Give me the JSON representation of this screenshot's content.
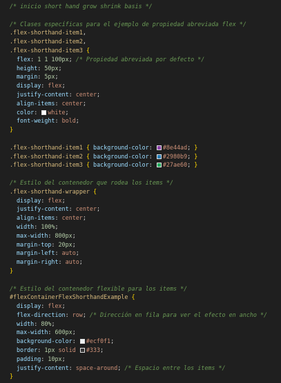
{
  "lines": [
    [
      {
        "t": "/* inicio short hand grow shrink basis */",
        "c": "comment"
      }
    ],
    [],
    [
      {
        "t": "/* Clases específicas para el ejemplo de propiedad abreviada flex */",
        "c": "comment"
      }
    ],
    [
      {
        "t": ".flex-shorthand-item1",
        "c": "selector"
      },
      {
        "t": ",",
        "c": "punct"
      }
    ],
    [
      {
        "t": ".flex-shorthand-item2",
        "c": "selector"
      },
      {
        "t": ",",
        "c": "punct"
      }
    ],
    [
      {
        "t": ".flex-shorthand-item3",
        "c": "selector"
      },
      {
        "t": " ",
        "c": "punct"
      },
      {
        "t": "{",
        "c": "brace"
      }
    ],
    [
      {
        "indent": 1
      },
      {
        "t": "flex",
        "c": "prop"
      },
      {
        "t": ": ",
        "c": "punct"
      },
      {
        "t": "1 1 100px",
        "c": "number"
      },
      {
        "t": "; ",
        "c": "punct"
      },
      {
        "t": "/* Propiedad abreviada por defecto */",
        "c": "comment"
      }
    ],
    [
      {
        "indent": 1
      },
      {
        "t": "height",
        "c": "prop"
      },
      {
        "t": ": ",
        "c": "punct"
      },
      {
        "t": "50px",
        "c": "number"
      },
      {
        "t": ";",
        "c": "punct"
      }
    ],
    [
      {
        "indent": 1
      },
      {
        "t": "margin",
        "c": "prop"
      },
      {
        "t": ": ",
        "c": "punct"
      },
      {
        "t": "5px",
        "c": "number"
      },
      {
        "t": ";",
        "c": "punct"
      }
    ],
    [
      {
        "indent": 1
      },
      {
        "t": "display",
        "c": "prop"
      },
      {
        "t": ": ",
        "c": "punct"
      },
      {
        "t": "flex",
        "c": "value"
      },
      {
        "t": ";",
        "c": "punct"
      }
    ],
    [
      {
        "indent": 1
      },
      {
        "t": "justify-content",
        "c": "prop"
      },
      {
        "t": ": ",
        "c": "punct"
      },
      {
        "t": "center",
        "c": "value"
      },
      {
        "t": ";",
        "c": "punct"
      }
    ],
    [
      {
        "indent": 1
      },
      {
        "t": "align-items",
        "c": "prop"
      },
      {
        "t": ": ",
        "c": "punct"
      },
      {
        "t": "center",
        "c": "value"
      },
      {
        "t": ";",
        "c": "punct"
      }
    ],
    [
      {
        "indent": 1
      },
      {
        "t": "color",
        "c": "prop"
      },
      {
        "t": ": ",
        "c": "punct"
      },
      {
        "swatch": "#ffffff"
      },
      {
        "t": "white",
        "c": "value"
      },
      {
        "t": ";",
        "c": "punct"
      }
    ],
    [
      {
        "indent": 1
      },
      {
        "t": "font-weight",
        "c": "prop"
      },
      {
        "t": ": ",
        "c": "punct"
      },
      {
        "t": "bold",
        "c": "value"
      },
      {
        "t": ";",
        "c": "punct"
      }
    ],
    [
      {
        "t": "}",
        "c": "brace"
      }
    ],
    [],
    [
      {
        "t": ".flex-shorthand-item1",
        "c": "selector"
      },
      {
        "t": " ",
        "c": "punct"
      },
      {
        "t": "{",
        "c": "brace"
      },
      {
        "t": " ",
        "c": "punct"
      },
      {
        "t": "background-color",
        "c": "prop"
      },
      {
        "t": ": ",
        "c": "punct"
      },
      {
        "swatch": "#8e44ad"
      },
      {
        "t": "#8e44ad",
        "c": "value"
      },
      {
        "t": "; ",
        "c": "punct"
      },
      {
        "t": "}",
        "c": "brace"
      }
    ],
    [
      {
        "t": ".flex-shorthand-item2",
        "c": "selector"
      },
      {
        "t": " ",
        "c": "punct"
      },
      {
        "t": "{",
        "c": "brace"
      },
      {
        "t": " ",
        "c": "punct"
      },
      {
        "t": "background-color",
        "c": "prop"
      },
      {
        "t": ": ",
        "c": "punct"
      },
      {
        "swatch": "#2980b9"
      },
      {
        "t": "#2980b9",
        "c": "value"
      },
      {
        "t": "; ",
        "c": "punct"
      },
      {
        "t": "}",
        "c": "brace"
      }
    ],
    [
      {
        "t": ".flex-shorthand-item3",
        "c": "selector"
      },
      {
        "t": " ",
        "c": "punct"
      },
      {
        "t": "{",
        "c": "brace"
      },
      {
        "t": " ",
        "c": "punct"
      },
      {
        "t": "background-color",
        "c": "prop"
      },
      {
        "t": ": ",
        "c": "punct"
      },
      {
        "swatch": "#27ae60"
      },
      {
        "t": "#27ae60",
        "c": "value"
      },
      {
        "t": "; ",
        "c": "punct"
      },
      {
        "t": "}",
        "c": "brace"
      }
    ],
    [],
    [
      {
        "t": "/* Estilo del contenedor que rodea los items */",
        "c": "comment"
      }
    ],
    [
      {
        "t": ".flex-shorthand-wrapper",
        "c": "selector"
      },
      {
        "t": " ",
        "c": "punct"
      },
      {
        "t": "{",
        "c": "brace"
      }
    ],
    [
      {
        "indent": 1
      },
      {
        "t": "display",
        "c": "prop"
      },
      {
        "t": ": ",
        "c": "punct"
      },
      {
        "t": "flex",
        "c": "value"
      },
      {
        "t": ";",
        "c": "punct"
      }
    ],
    [
      {
        "indent": 1
      },
      {
        "t": "justify-content",
        "c": "prop"
      },
      {
        "t": ": ",
        "c": "punct"
      },
      {
        "t": "center",
        "c": "value"
      },
      {
        "t": ";",
        "c": "punct"
      }
    ],
    [
      {
        "indent": 1
      },
      {
        "t": "align-items",
        "c": "prop"
      },
      {
        "t": ": ",
        "c": "punct"
      },
      {
        "t": "center",
        "c": "value"
      },
      {
        "t": ";",
        "c": "punct"
      }
    ],
    [
      {
        "indent": 1
      },
      {
        "t": "width",
        "c": "prop"
      },
      {
        "t": ": ",
        "c": "punct"
      },
      {
        "t": "100%",
        "c": "number"
      },
      {
        "t": ";",
        "c": "punct"
      }
    ],
    [
      {
        "indent": 1
      },
      {
        "t": "max-width",
        "c": "prop"
      },
      {
        "t": ": ",
        "c": "punct"
      },
      {
        "t": "800px",
        "c": "number"
      },
      {
        "t": ";",
        "c": "punct"
      }
    ],
    [
      {
        "indent": 1
      },
      {
        "t": "margin-top",
        "c": "prop"
      },
      {
        "t": ": ",
        "c": "punct"
      },
      {
        "t": "20px",
        "c": "number"
      },
      {
        "t": ";",
        "c": "punct"
      }
    ],
    [
      {
        "indent": 1
      },
      {
        "t": "margin-left",
        "c": "prop"
      },
      {
        "t": ": ",
        "c": "punct"
      },
      {
        "t": "auto",
        "c": "value"
      },
      {
        "t": ";",
        "c": "punct"
      }
    ],
    [
      {
        "indent": 1
      },
      {
        "t": "margin-right",
        "c": "prop"
      },
      {
        "t": ": ",
        "c": "punct"
      },
      {
        "t": "auto",
        "c": "value"
      },
      {
        "t": ";",
        "c": "punct"
      }
    ],
    [
      {
        "t": "}",
        "c": "brace"
      }
    ],
    [],
    [
      {
        "t": "/* Estilo del contenedor flexible para los items */",
        "c": "comment"
      }
    ],
    [
      {
        "t": "#flexContainerFlexShorthandExample",
        "c": "selector"
      },
      {
        "t": " ",
        "c": "punct"
      },
      {
        "t": "{",
        "c": "brace"
      }
    ],
    [
      {
        "indent": 1
      },
      {
        "t": "display",
        "c": "prop"
      },
      {
        "t": ": ",
        "c": "punct"
      },
      {
        "t": "flex",
        "c": "value"
      },
      {
        "t": ";",
        "c": "punct"
      }
    ],
    [
      {
        "indent": 1
      },
      {
        "t": "flex-direction",
        "c": "prop"
      },
      {
        "t": ": ",
        "c": "punct"
      },
      {
        "t": "row",
        "c": "value"
      },
      {
        "t": "; ",
        "c": "punct"
      },
      {
        "t": "/* Dirección en fila para ver el efecto en ancho */",
        "c": "comment"
      }
    ],
    [
      {
        "indent": 1
      },
      {
        "t": "width",
        "c": "prop"
      },
      {
        "t": ": ",
        "c": "punct"
      },
      {
        "t": "80%",
        "c": "number"
      },
      {
        "t": ";",
        "c": "punct"
      }
    ],
    [
      {
        "indent": 1
      },
      {
        "t": "max-width",
        "c": "prop"
      },
      {
        "t": ": ",
        "c": "punct"
      },
      {
        "t": "600px",
        "c": "number"
      },
      {
        "t": ";",
        "c": "punct"
      }
    ],
    [
      {
        "indent": 1
      },
      {
        "t": "background-color",
        "c": "prop"
      },
      {
        "t": ": ",
        "c": "punct"
      },
      {
        "swatch": "#ecf0f1"
      },
      {
        "t": "#ecf0f1",
        "c": "value"
      },
      {
        "t": ";",
        "c": "punct"
      }
    ],
    [
      {
        "indent": 1
      },
      {
        "t": "border",
        "c": "prop"
      },
      {
        "t": ": ",
        "c": "punct"
      },
      {
        "t": "1px",
        "c": "number"
      },
      {
        "t": " ",
        "c": "punct"
      },
      {
        "t": "solid",
        "c": "value"
      },
      {
        "t": " ",
        "c": "punct"
      },
      {
        "swatch": "#333333"
      },
      {
        "t": "#333",
        "c": "value"
      },
      {
        "t": ";",
        "c": "punct"
      }
    ],
    [
      {
        "indent": 1
      },
      {
        "t": "padding",
        "c": "prop"
      },
      {
        "t": ": ",
        "c": "punct"
      },
      {
        "t": "10px",
        "c": "number"
      },
      {
        "t": ";",
        "c": "punct"
      }
    ],
    [
      {
        "indent": 1
      },
      {
        "t": "justify-content",
        "c": "prop"
      },
      {
        "t": ": ",
        "c": "punct"
      },
      {
        "t": "space-around",
        "c": "value"
      },
      {
        "t": "; ",
        "c": "punct"
      },
      {
        "t": "/* Espacio entre los items */",
        "c": "comment"
      }
    ],
    [
      {
        "t": "}",
        "c": "brace"
      }
    ]
  ],
  "theme": {
    "background": "#1f1f1f",
    "comment": "#6a9955",
    "selector": "#d7ba7d",
    "property": "#9cdcfe",
    "value": "#ce9178",
    "number": "#b5cea8",
    "brace": "#ffd700"
  }
}
